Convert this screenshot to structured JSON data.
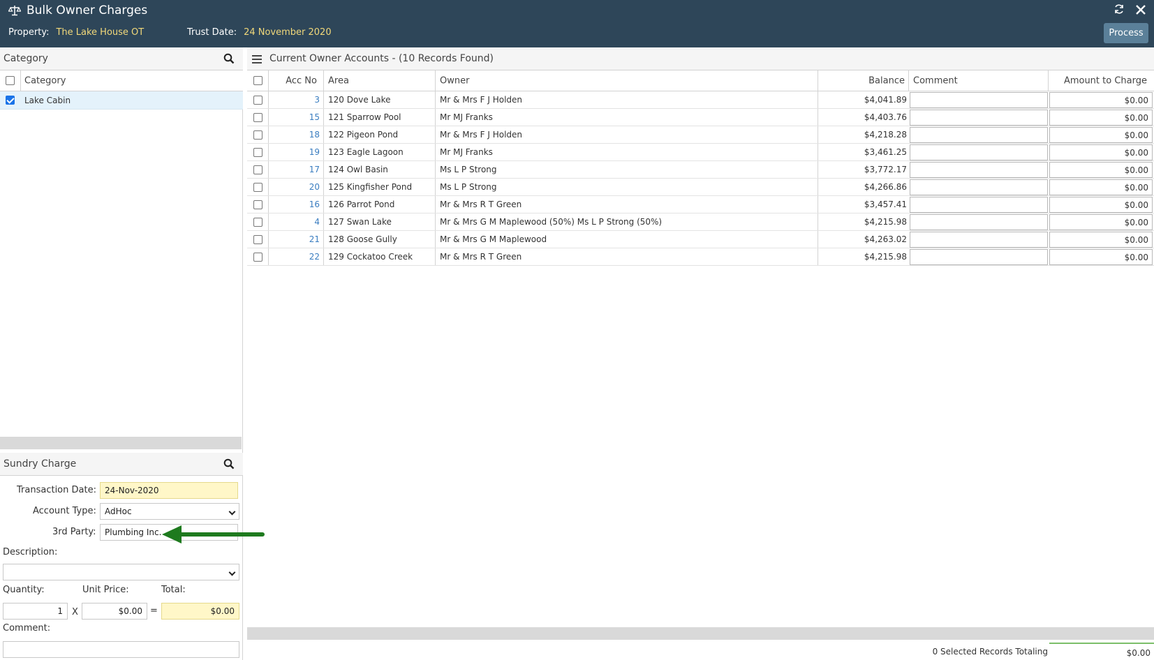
{
  "header": {
    "title": "Bulk Owner Charges",
    "property_label": "Property:",
    "property_value": "The Lake House OT",
    "trust_date_label": "Trust Date:",
    "trust_date_value": "24 November 2020",
    "process_label": "Process",
    "icons": {
      "title": "scales-icon",
      "refresh": "refresh-icon",
      "close": "close-icon"
    }
  },
  "category_panel": {
    "title": "Category",
    "column_header": "Category",
    "rows": [
      {
        "label": "Lake Cabin",
        "checked": true
      }
    ]
  },
  "sundry_panel": {
    "title": "Sundry Charge",
    "transaction_date_label": "Transaction Date:",
    "transaction_date_value": "24-Nov-2020",
    "account_type_label": "Account Type:",
    "account_type_value": "AdHoc",
    "third_party_label": "3rd Party:",
    "third_party_value": "Plumbing Inc.",
    "description_label": "Description:",
    "description_value": "",
    "quantity_label": "Quantity:",
    "quantity_value": "1",
    "unit_price_label": "Unit Price:",
    "unit_price_value": "$0.00",
    "total_label": "Total:",
    "total_value": "$0.00",
    "multiply_symbol": "X",
    "equals_symbol": "=",
    "comment_label": "Comment:",
    "comment_value": ""
  },
  "grid": {
    "title": "Current Owner Accounts - (10 Records Found)",
    "columns": {
      "acc_no": "Acc No",
      "area": "Area",
      "owner": "Owner",
      "balance": "Balance",
      "comment": "Comment",
      "amount": "Amount to Charge"
    },
    "rows": [
      {
        "acc_no": "3",
        "area": "120 Dove Lake",
        "owner": "Mr & Mrs F J Holden",
        "balance": "$4,041.89",
        "amount": "$0.00"
      },
      {
        "acc_no": "15",
        "area": "121 Sparrow Pool",
        "owner": "Mr MJ Franks",
        "balance": "$4,403.76",
        "amount": "$0.00"
      },
      {
        "acc_no": "18",
        "area": "122 Pigeon Pond",
        "owner": "Mr & Mrs F J Holden",
        "balance": "$4,218.28",
        "amount": "$0.00"
      },
      {
        "acc_no": "19",
        "area": "123 Eagle Lagoon",
        "owner": "Mr MJ Franks",
        "balance": "$3,461.25",
        "amount": "$0.00"
      },
      {
        "acc_no": "17",
        "area": "124 Owl Basin",
        "owner": "Ms L P Strong",
        "balance": "$3,772.17",
        "amount": "$0.00"
      },
      {
        "acc_no": "20",
        "area": "125 Kingfisher Pond",
        "owner": "Ms L P Strong",
        "balance": "$4,266.86",
        "amount": "$0.00"
      },
      {
        "acc_no": "16",
        "area": "126 Parrot Pond",
        "owner": "Mr & Mrs R T Green",
        "balance": "$3,457.41",
        "amount": "$0.00"
      },
      {
        "acc_no": "4",
        "area": "127 Swan Lake",
        "owner": "Mr & Mrs G M Maplewood (50%) Ms L P Strong (50%)",
        "balance": "$4,215.98",
        "amount": "$0.00"
      },
      {
        "acc_no": "21",
        "area": "128 Goose Gully",
        "owner": "Mr & Mrs G M Maplewood",
        "balance": "$4,263.02",
        "amount": "$0.00"
      },
      {
        "acc_no": "22",
        "area": "129 Cockatoo Creek",
        "owner": "Mr & Mrs R T Green",
        "balance": "$4,215.98",
        "amount": "$0.00"
      }
    ],
    "footer_text": "0 Selected Records Totaling",
    "footer_total": "$0.00"
  },
  "colors": {
    "header_bg": "#2e4659",
    "header_value": "#f1d87a",
    "accent": "#3a7dc0",
    "arrow": "#1e7a1e",
    "highlight_row": "#e4f2fb"
  }
}
